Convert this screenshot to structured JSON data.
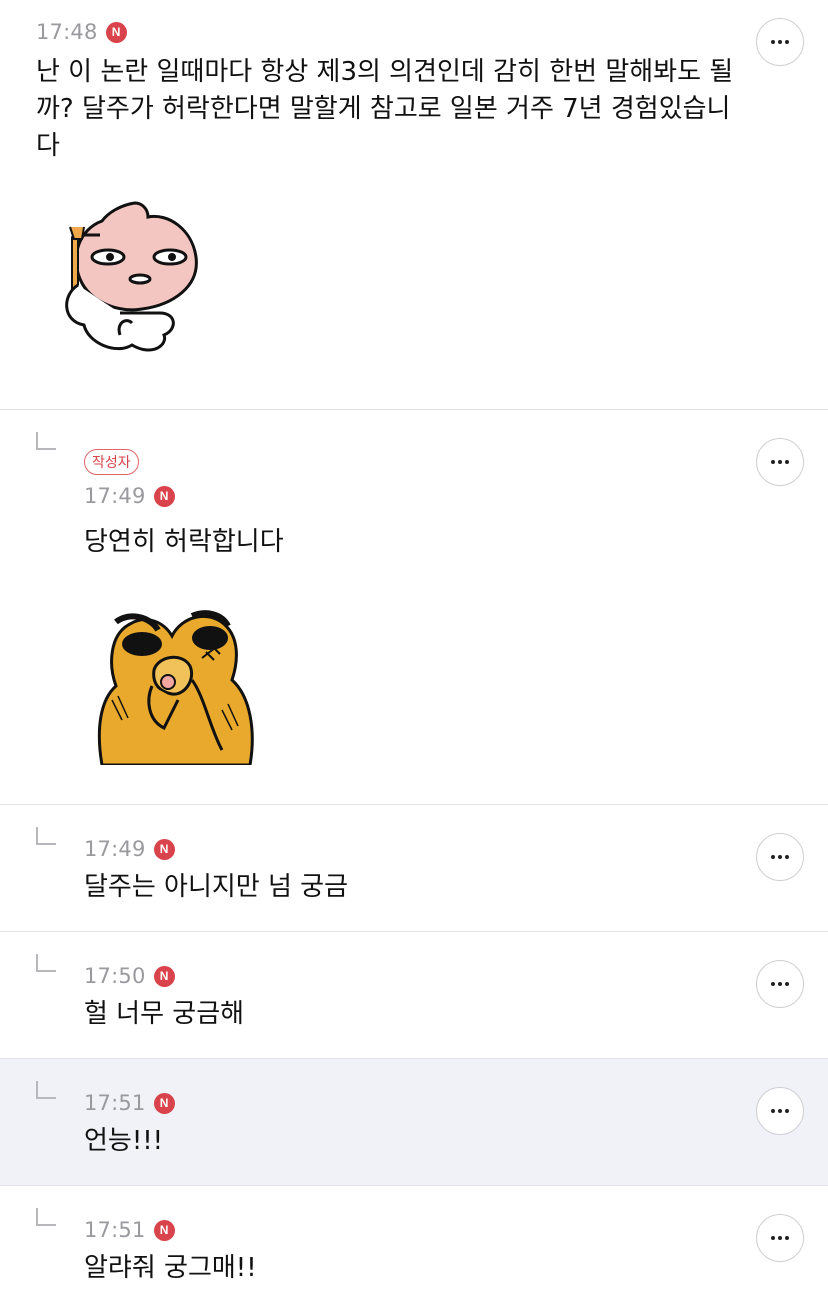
{
  "comments": [
    {
      "time": "17:48",
      "new_badge": "N",
      "text": "난 이 논란 일때마다 항상 제3의 의견인데 감히 한번 말해봐도 될까? 달주가 허락한다면 말할게 참고로 일본 거주 7년 경험있습니다",
      "sticker": "apeach-sticker"
    },
    {
      "author_badge": "작성자",
      "time": "17:49",
      "new_badge": "N",
      "text": "당연히 허락합니다",
      "sticker": "ryan-sticker"
    },
    {
      "time": "17:49",
      "new_badge": "N",
      "text": "달주는 아니지만 넘 궁금"
    },
    {
      "time": "17:50",
      "new_badge": "N",
      "text": "헐 너무 궁금해"
    },
    {
      "time": "17:51",
      "new_badge": "N",
      "text": "언능!!!"
    },
    {
      "time": "17:51",
      "new_badge": "N",
      "text": "알랴줘 궁그매!!"
    }
  ],
  "colors": {
    "new_badge": "#d9434b",
    "highlight_bg": "#f1f2f7",
    "time_text": "#9a9a9e",
    "divider": "#e3e3e6"
  },
  "icons": {
    "more": "more-icon",
    "reply": "reply-arrow-icon",
    "new": "new-badge-icon"
  }
}
